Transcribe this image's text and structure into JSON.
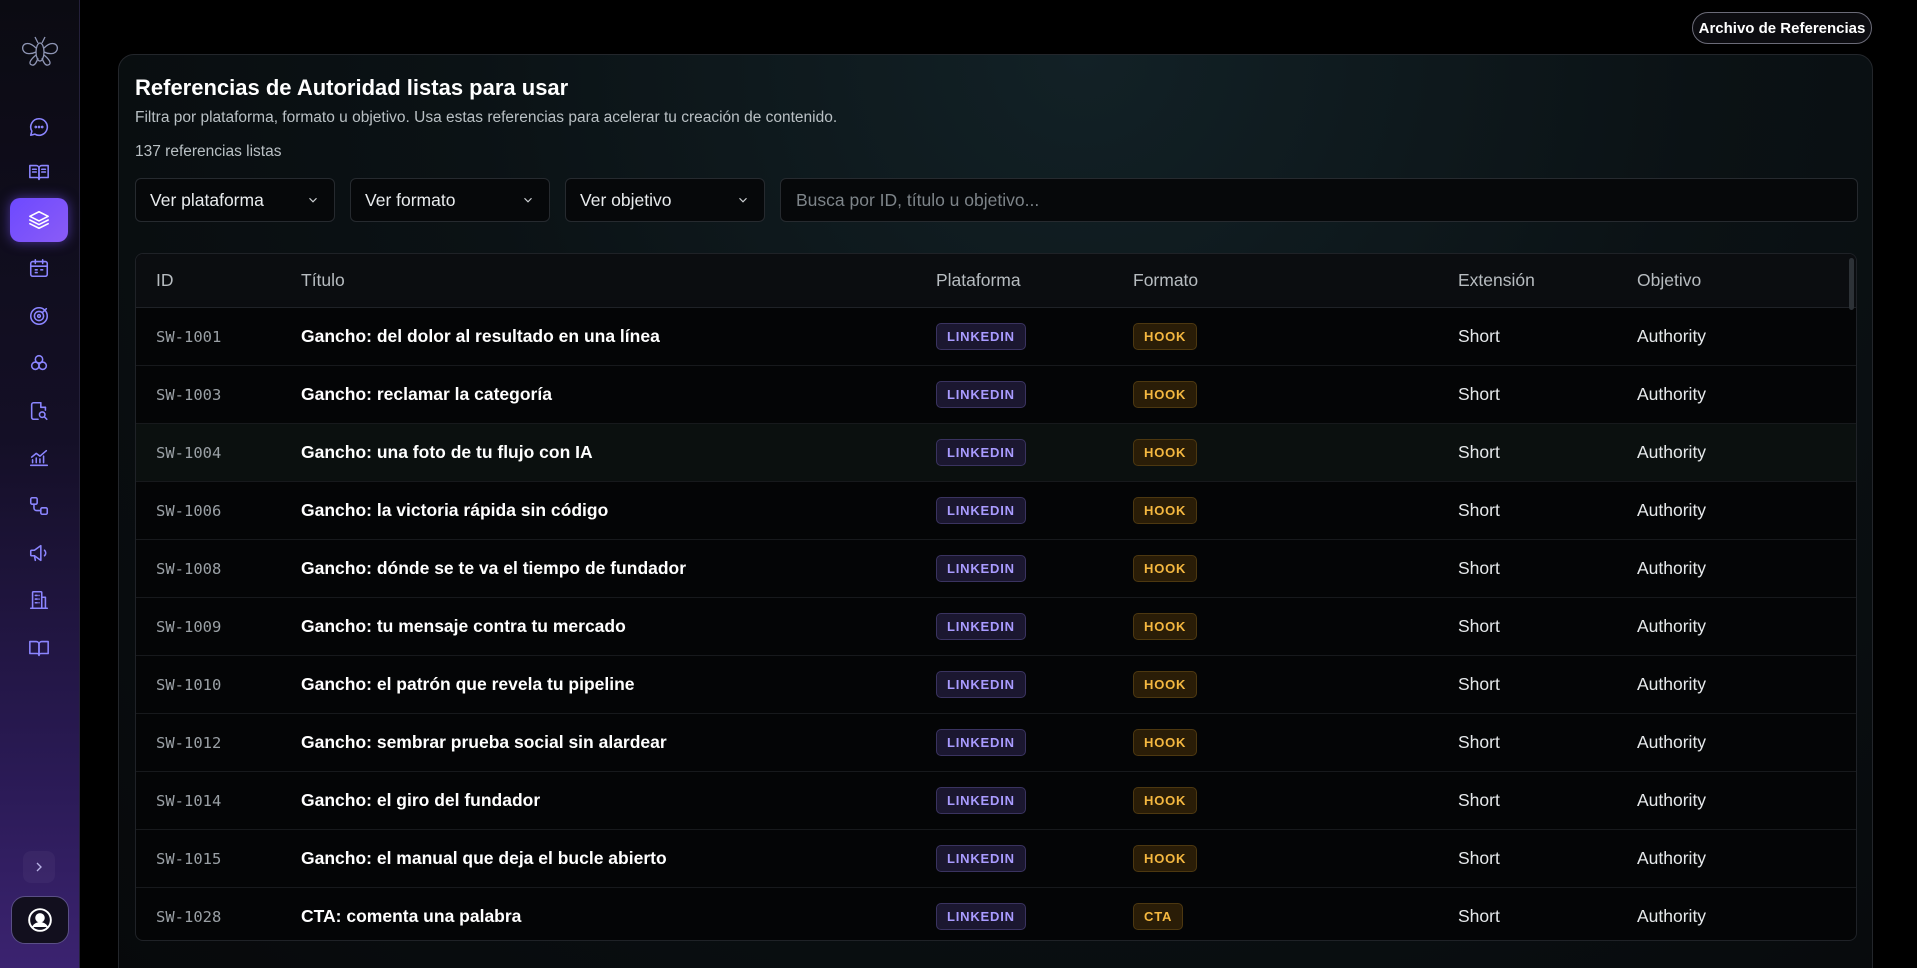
{
  "top": {
    "archive_button": "Archivo de Referencias"
  },
  "header": {
    "title": "Referencias de Autoridad listas para usar",
    "subtitle": "Filtra por plataforma, formato u objetivo. Usa estas referencias para acelerar tu creación de contenido.",
    "count": "137 referencias listas"
  },
  "filters": {
    "platform": "Ver plataforma",
    "format": "Ver formato",
    "objective": "Ver objetivo",
    "search_placeholder": "Busca por ID, título u objetivo..."
  },
  "table": {
    "columns": [
      "ID",
      "Título",
      "Plataforma",
      "Formato",
      "Extensión",
      "Objetivo"
    ],
    "rows": [
      {
        "id": "SW-1001",
        "title": "Gancho: del dolor al resultado en una línea",
        "platform": "LINKEDIN",
        "format": "HOOK",
        "extension": "Short",
        "objective": "Authority"
      },
      {
        "id": "SW-1003",
        "title": "Gancho: reclamar la categoría",
        "platform": "LINKEDIN",
        "format": "HOOK",
        "extension": "Short",
        "objective": "Authority"
      },
      {
        "id": "SW-1004",
        "title": "Gancho: una foto de tu flujo con IA",
        "platform": "LINKEDIN",
        "format": "HOOK",
        "extension": "Short",
        "objective": "Authority"
      },
      {
        "id": "SW-1006",
        "title": "Gancho: la victoria rápida sin código",
        "platform": "LINKEDIN",
        "format": "HOOK",
        "extension": "Short",
        "objective": "Authority"
      },
      {
        "id": "SW-1008",
        "title": "Gancho: dónde se te va el tiempo de fundador",
        "platform": "LINKEDIN",
        "format": "HOOK",
        "extension": "Short",
        "objective": "Authority"
      },
      {
        "id": "SW-1009",
        "title": "Gancho: tu mensaje contra tu mercado",
        "platform": "LINKEDIN",
        "format": "HOOK",
        "extension": "Short",
        "objective": "Authority"
      },
      {
        "id": "SW-1010",
        "title": "Gancho: el patrón que revela tu pipeline",
        "platform": "LINKEDIN",
        "format": "HOOK",
        "extension": "Short",
        "objective": "Authority"
      },
      {
        "id": "SW-1012",
        "title": "Gancho: sembrar prueba social sin alardear",
        "platform": "LINKEDIN",
        "format": "HOOK",
        "extension": "Short",
        "objective": "Authority"
      },
      {
        "id": "SW-1014",
        "title": "Gancho: el giro del fundador",
        "platform": "LINKEDIN",
        "format": "HOOK",
        "extension": "Short",
        "objective": "Authority"
      },
      {
        "id": "SW-1015",
        "title": "Gancho: el manual que deja el bucle abierto",
        "platform": "LINKEDIN",
        "format": "HOOK",
        "extension": "Short",
        "objective": "Authority"
      },
      {
        "id": "SW-1028",
        "title": "CTA: comenta una palabra",
        "platform": "LINKEDIN",
        "format": "CTA",
        "extension": "Short",
        "objective": "Authority"
      }
    ]
  },
  "sidebar": {
    "items": [
      {
        "icon": "chat-bubble-icon"
      },
      {
        "icon": "open-book-icon"
      },
      {
        "icon": "layers-icon",
        "active": true
      },
      {
        "icon": "calendar-icon"
      },
      {
        "icon": "target-icon"
      },
      {
        "icon": "circles-icon"
      },
      {
        "icon": "file-search-icon"
      },
      {
        "icon": "line-chart-icon"
      },
      {
        "icon": "workflow-icon"
      },
      {
        "icon": "megaphone-icon"
      },
      {
        "icon": "building-icon"
      },
      {
        "icon": "book-icon"
      }
    ]
  },
  "colors": {
    "accent": "#7a54ff",
    "platform_badge": "#a99bff",
    "format_badge": "#f5b840"
  }
}
